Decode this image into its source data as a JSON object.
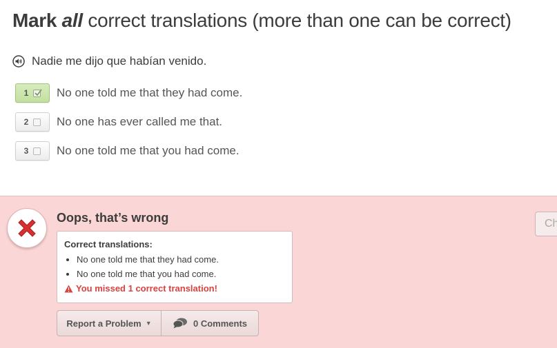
{
  "header": {
    "title_mark": "Mark",
    "title_all": "all",
    "title_rest": "correct translations (more than one can be correct)"
  },
  "prompt": {
    "icon": "speaker-icon",
    "sentence": "Nadie me dijo que habían venido."
  },
  "options": [
    {
      "number": "1",
      "text": "No one told me that they had come.",
      "checked": true
    },
    {
      "number": "2",
      "text": "No one has ever called me that.",
      "checked": false
    },
    {
      "number": "3",
      "text": "No one told me that you had come.",
      "checked": false
    }
  ],
  "feedback": {
    "verdict": "Oops, that’s wrong",
    "solution_heading": "Correct translations:",
    "solutions": [
      "No one told me that they had come.",
      "No one told me that you had come."
    ],
    "missed_message": "You missed 1 correct translation!",
    "report_label": "Report a Problem",
    "comments_label": "0 Comments",
    "continue_label": "Ch"
  },
  "colors": {
    "feedback_bg": "#fbd6d6",
    "error_red": "#d9413f",
    "checked_green": "#c3e09f"
  }
}
